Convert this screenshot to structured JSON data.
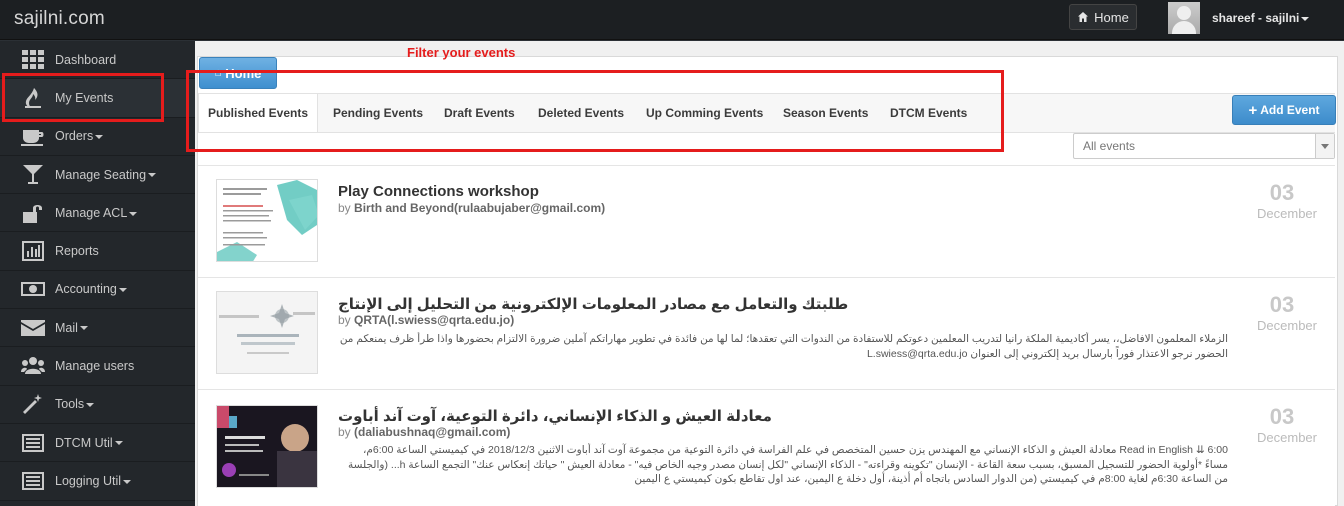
{
  "brand": "sajilni.com",
  "topbar": {
    "home_label": "Home",
    "user_name": "shareef - sajilni"
  },
  "sidebar": {
    "items": [
      {
        "label": "Dashboard",
        "icon": "grid-icon"
      },
      {
        "label": "My Events",
        "icon": "flame-icon"
      },
      {
        "label": "Orders",
        "icon": "cup-icon"
      },
      {
        "label": "Manage Seating",
        "icon": "glass-icon"
      },
      {
        "label": "Manage ACL",
        "icon": "lock-icon"
      },
      {
        "label": "Reports",
        "icon": "bar-chart-icon"
      },
      {
        "label": "Accounting",
        "icon": "money-icon"
      },
      {
        "label": "Mail",
        "icon": "envelope-icon"
      },
      {
        "label": "Manage users",
        "icon": "users-icon"
      },
      {
        "label": "Tools",
        "icon": "wand-icon"
      },
      {
        "label": "DTCM Util",
        "icon": "list-icon"
      },
      {
        "label": "Logging Util",
        "icon": "list-icon"
      }
    ]
  },
  "main": {
    "home_tab": "Home",
    "filter_note": "Filter your events",
    "tabs": [
      "Published Events",
      "Pending Events",
      "Draft Events",
      "Deleted Events",
      "Up Comming Events",
      "Season Events",
      "DTCM Events"
    ],
    "add_event": "Add Event",
    "filter_value": "All events"
  },
  "events": [
    {
      "title": "Play Connections workshop",
      "by_prefix": "by",
      "organizer": "Birth and Beyond",
      "email": "(rulaabujaber@gmail.com)",
      "desc": "",
      "day": "03",
      "month": "December"
    },
    {
      "title": "طلبتك والتعامل مع مصادر المعلومات الإلكترونية من التحليل إلى الإنتاج",
      "by_prefix": "by",
      "organizer": "QRTA",
      "email": "(l.swiess@qrta.edu.jo)",
      "desc": "الزملاء المعلمون الافاضل،، يسر أكاديمية الملكة رانيا لتدريب المعلمين دعوتكم للاستفادة من الندوات التي تعقدها؛ لما لها من فائدة في تطوير مهاراتكم آملين ضرورة الالتزام بحضورها واذا طرأ ظرف يمنعكم من الحضور نرجو الاعتذار فوراً بارسال بريد إلكتروني إلى العنوان L.swiess@qrta.edu.jo",
      "day": "03",
      "month": "December"
    },
    {
      "title": "معادلة العيش و الذكاء الإنساني، دائرة التوعية، آوت آند أباوت",
      "by_prefix": "by",
      "organizer": "",
      "email": "(daliabushnaq@gmail.com)",
      "desc": "Read in English ⇊ 6:00 معادلة العيش و الذكاء الإنساني مع المهندس يزن حسين المتخصص في علم الفراسة في دائرة التوعية من مجموعة آوت آند أباوت الاثنين 2018/12/3 في كيميستي الساعة 6:00م، مساءً *أولوية الحضور للتسجيل المسبق، بسبب سعة القاعة - الإنسان \"تكوينه وقراءته\" - الذكاء الإنساني \"لكل إنسان مصدر وجيه الخاص فيه\" - معادلة العيش \" حياتك إنعكاس عنك\" التجمع الساعة h... (والجلسة من الساعة 6:30م لغاية 8:00م في كيميستي (من الدوار السادس باتجاه أم أذينة، أول دخلة ع اليمين، عند اول تقاطع بكون كيميستي ع اليمين",
      "day": "03",
      "month": "December"
    }
  ],
  "colors": {
    "sidebar_bg": "#23272b",
    "topbar_bg": "#1c1f22",
    "accent_blue": "#3d8ccb",
    "annotation_red": "#e51c1c"
  }
}
